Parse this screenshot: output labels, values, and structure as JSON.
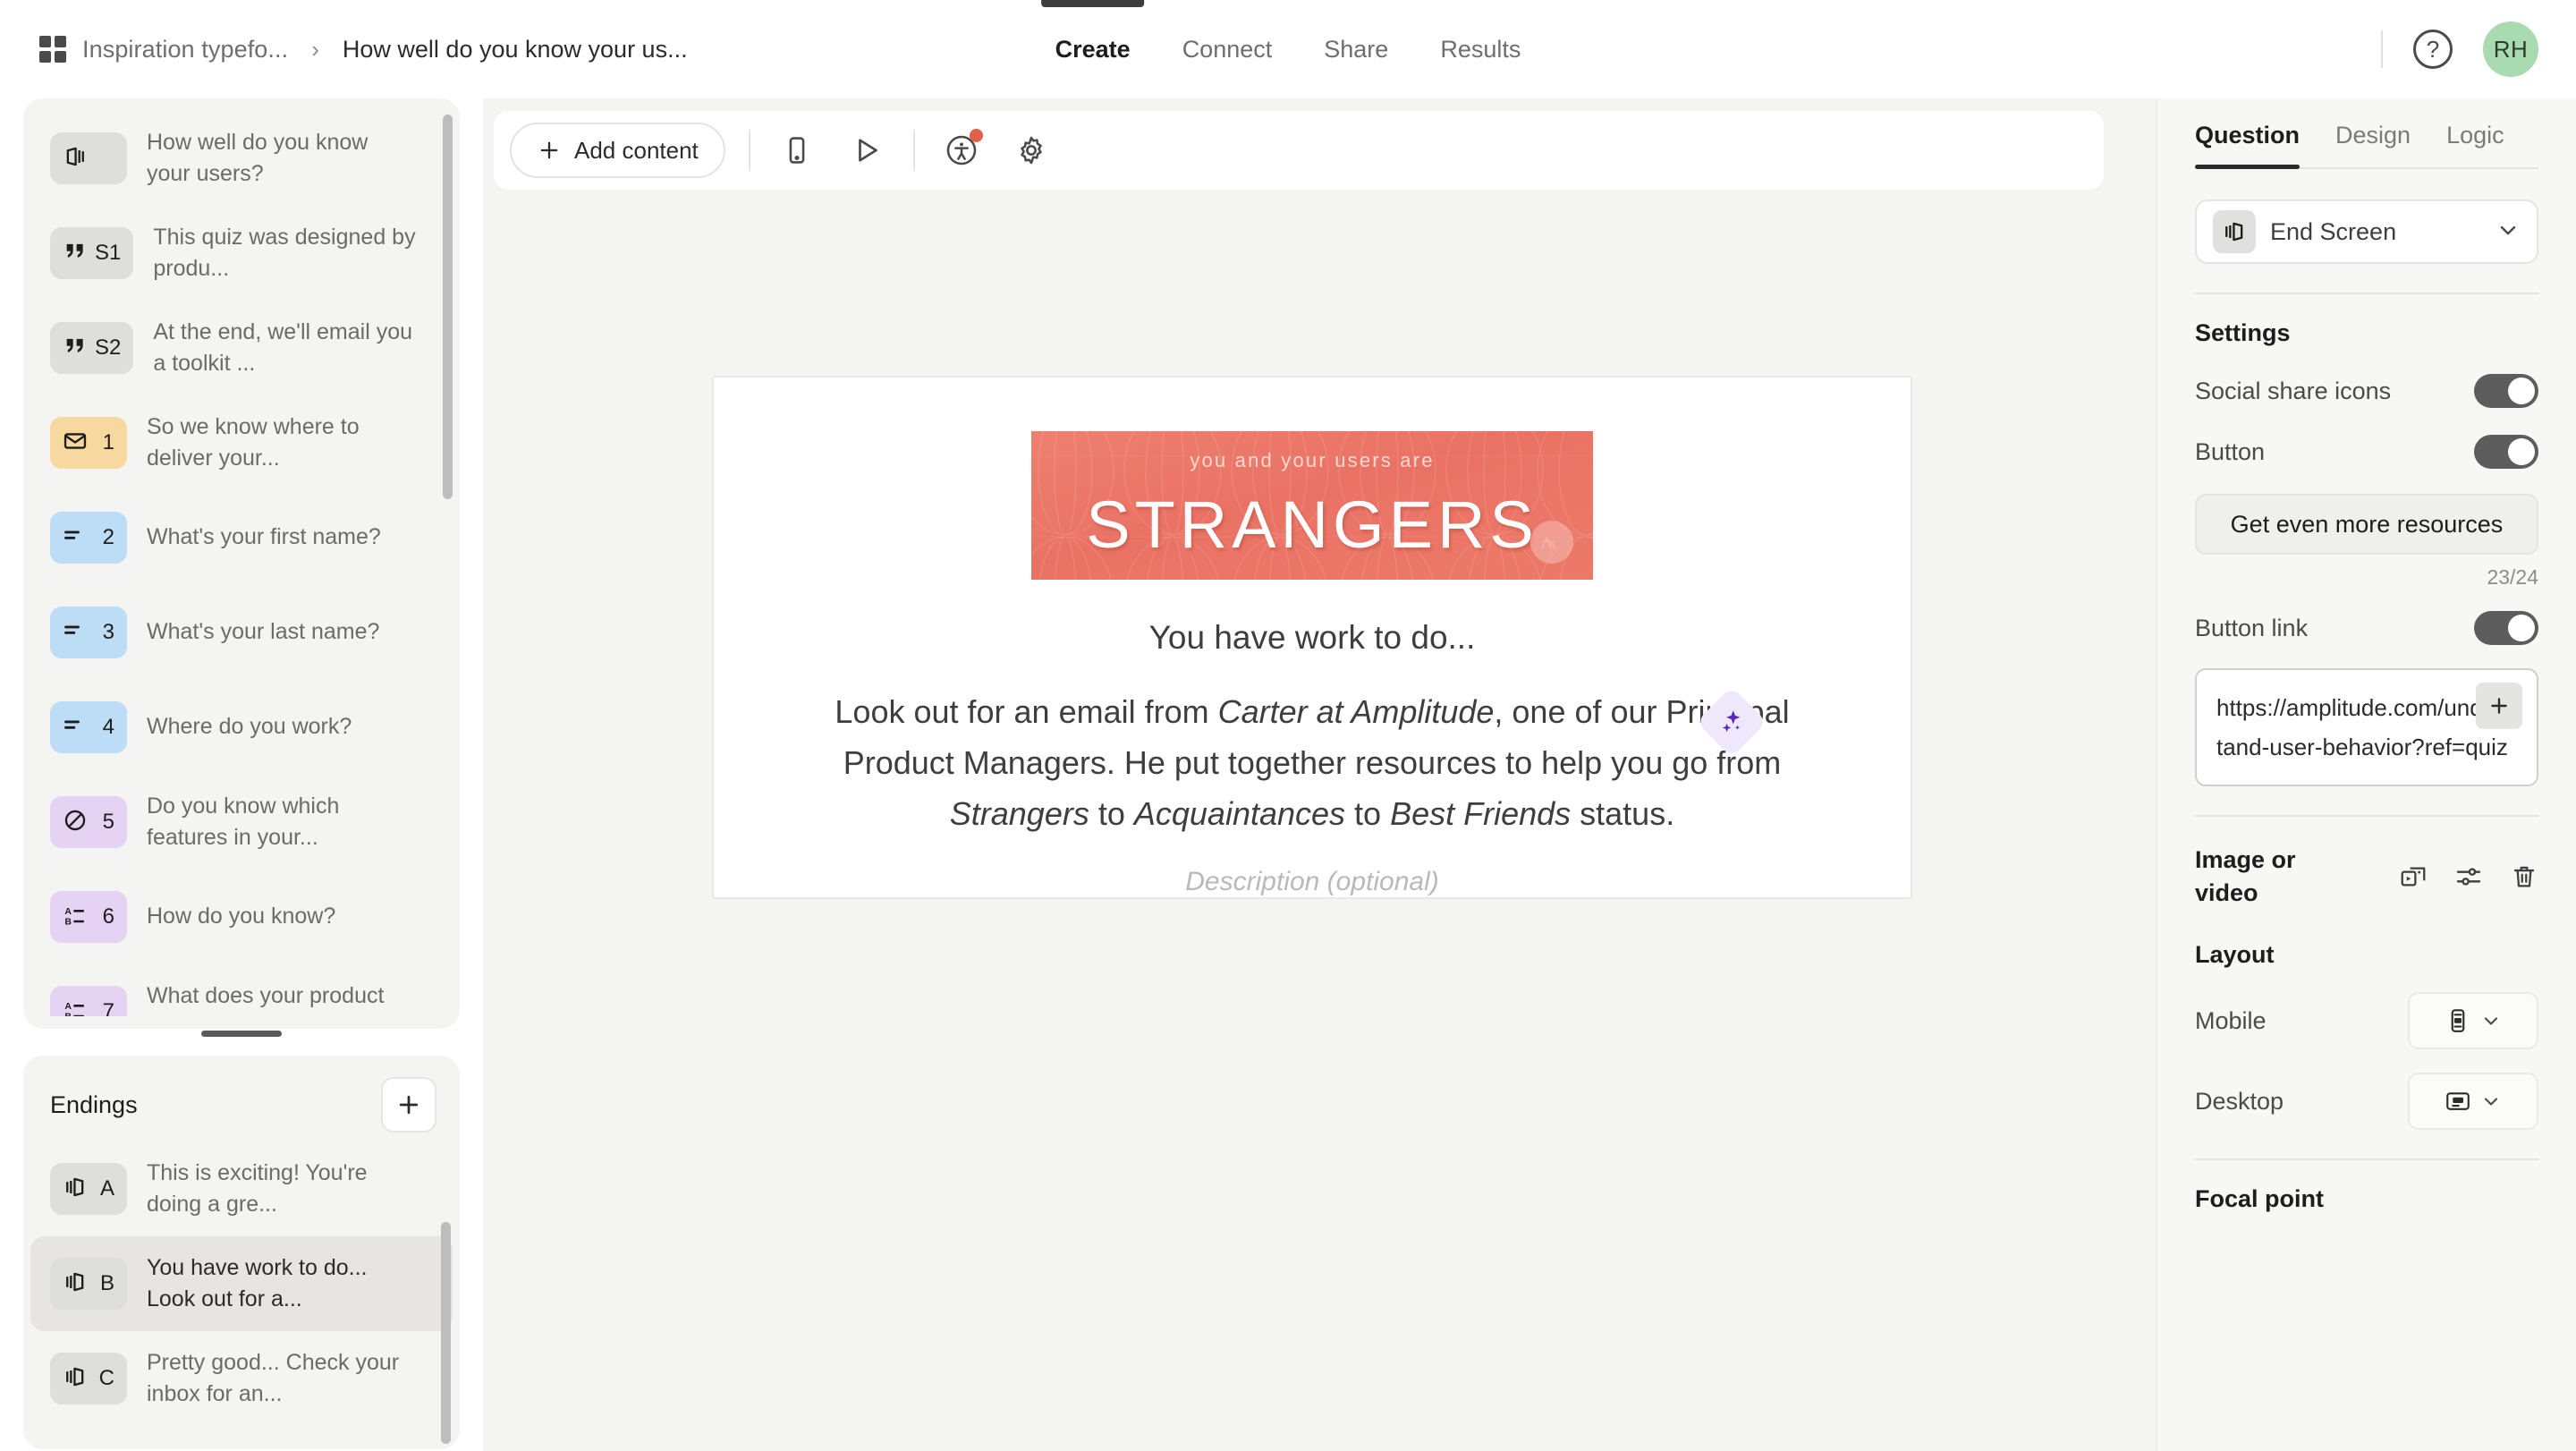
{
  "header": {
    "breadcrumb_workspace": "Inspiration typefo...",
    "breadcrumb_separator": "›",
    "breadcrumb_current": "How well do you know your us...",
    "tabs": [
      {
        "label": "Create",
        "active": true
      },
      {
        "label": "Connect",
        "active": false
      },
      {
        "label": "Share",
        "active": false
      },
      {
        "label": "Results",
        "active": false
      }
    ],
    "help_glyph": "?",
    "avatar_initials": "RH"
  },
  "sidebar": {
    "questions": [
      {
        "badge": "",
        "badge_color": "gray",
        "icon": "welcome-screen-icon",
        "label": "How well do you know your users?",
        "selected": false
      },
      {
        "badge": "S1",
        "badge_color": "gray",
        "icon": "statement-icon",
        "label": "This quiz was designed by produ...",
        "selected": false
      },
      {
        "badge": "S2",
        "badge_color": "gray",
        "icon": "statement-icon",
        "label": "At the end, we'll email you a toolkit ...",
        "selected": false
      },
      {
        "badge": "1",
        "badge_color": "amber",
        "icon": "email-icon",
        "label": "So we know where to deliver your...",
        "selected": false
      },
      {
        "badge": "2",
        "badge_color": "blue",
        "icon": "short-text-icon",
        "label": "What's your first name?",
        "selected": false
      },
      {
        "badge": "3",
        "badge_color": "blue",
        "icon": "short-text-icon",
        "label": "What's your last name?",
        "selected": false
      },
      {
        "badge": "4",
        "badge_color": "blue",
        "icon": "short-text-icon",
        "label": "Where do you work?",
        "selected": false
      },
      {
        "badge": "5",
        "badge_color": "purple",
        "icon": "yes-no-icon",
        "label": "Do you know which features in your...",
        "selected": false
      },
      {
        "badge": "6",
        "badge_color": "purple",
        "icon": "multiple-choice-icon",
        "label": "How do you know?",
        "selected": false
      },
      {
        "badge": "7",
        "badge_color": "purple",
        "icon": "multiple-choice-icon",
        "label": "What does your product team do...",
        "selected": false
      }
    ],
    "endings_title": "Endings",
    "endings": [
      {
        "badge": "A",
        "icon": "end-screen-icon",
        "label": "This is exciting! You're doing a gre...",
        "selected": false
      },
      {
        "badge": "B",
        "icon": "end-screen-icon",
        "label": "You have work to do... Look out for a...",
        "selected": true
      },
      {
        "badge": "C",
        "icon": "end-screen-icon",
        "label": "Pretty good... Check your inbox for an...",
        "selected": false
      }
    ]
  },
  "toolbar": {
    "add_content_label": "Add content",
    "icons": [
      "mobile-preview-icon",
      "play-preview-icon",
      "accessibility-icon",
      "settings-gear-icon"
    ],
    "accessibility_has_alert": true
  },
  "canvas": {
    "hero": {
      "kicker": "you and your users are",
      "title": "STRANGERS",
      "logo": "amplitude-logo",
      "background_color": "#ea7264"
    },
    "title": "You have work to do...",
    "body_segments": [
      {
        "text": "Look out for an email from ",
        "italic": false
      },
      {
        "text": "Carter at Amplitude",
        "italic": true
      },
      {
        "text": ", one of our Principal Product Managers. He put together resources to help you go from ",
        "italic": false
      },
      {
        "text": "Strangers",
        "italic": true
      },
      {
        "text": " to ",
        "italic": false
      },
      {
        "text": "Acquaintances",
        "italic": true
      },
      {
        "text": " to ",
        "italic": false
      },
      {
        "text": "Best Friends",
        "italic": true
      },
      {
        "text": " status.",
        "italic": false
      }
    ],
    "description_placeholder": "Description (optional)",
    "ai_badge": "ai-sparkle-icon"
  },
  "rightpanel": {
    "tabs": [
      {
        "label": "Question",
        "active": true
      },
      {
        "label": "Design",
        "active": false
      },
      {
        "label": "Logic",
        "active": false
      }
    ],
    "type_select": {
      "icon": "end-screen-icon",
      "value": "End Screen",
      "chevron": "chevron-down-icon"
    },
    "settings_title": "Settings",
    "social_share_label": "Social share icons",
    "social_share_on": true,
    "button_label": "Button",
    "button_on": true,
    "button_text": "Get even more resources",
    "button_char_count": "23/24",
    "button_link_label": "Button link",
    "button_link_on": true,
    "button_link_url": "https://amplitude.com/understand-user-behavior?ref=quiz",
    "media_label": "Image or video",
    "media_icons": [
      "replace-media-icon",
      "adjust-media-icon",
      "delete-media-icon"
    ],
    "layout_title": "Layout",
    "mobile_label": "Mobile",
    "mobile_layout": "stack-layout-icon",
    "desktop_label": "Desktop",
    "desktop_layout": "wide-layout-icon",
    "focal_point_title": "Focal point"
  }
}
